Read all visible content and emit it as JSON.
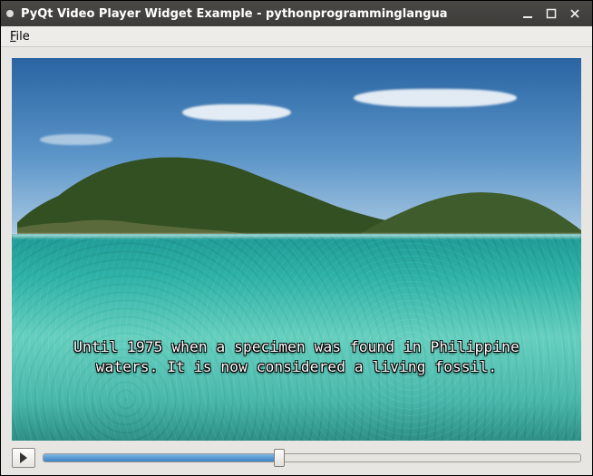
{
  "window": {
    "title": "PyQt Video Player Widget Example - pythonprogramminglangua"
  },
  "menubar": {
    "file_label": "File",
    "file_mnemonic": "F"
  },
  "video": {
    "subtitle_line1": "Until 1975 when a specimen was found in Philippine",
    "subtitle_line2": "waters. It is now considered a living fossil."
  },
  "controls": {
    "play_icon": "play-icon",
    "position_percent": 44
  },
  "colors": {
    "titlebar": "#3c3b38",
    "accent_blue": "#3b82c4",
    "sea": "#2fb0a6",
    "sky": "#5a94c8"
  }
}
